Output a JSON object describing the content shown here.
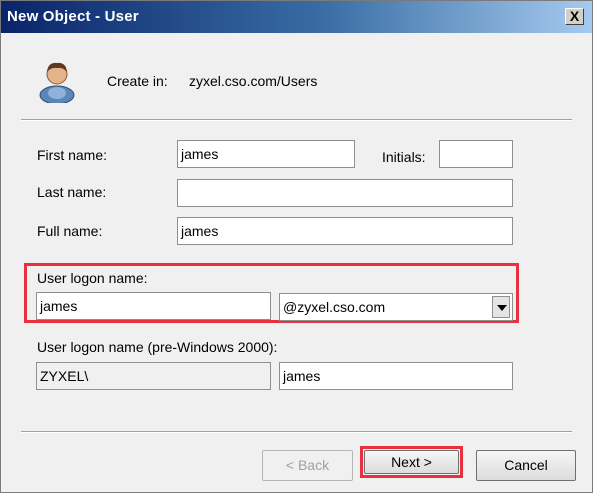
{
  "window": {
    "title": "New Object - User",
    "close_label": "X"
  },
  "header": {
    "create_in_label": "Create in:",
    "create_in_path": "zyxel.cso.com/Users",
    "icon": "user-icon"
  },
  "form": {
    "first_name_label": "First name:",
    "first_name_value": "james",
    "initials_label": "Initials:",
    "initials_value": "",
    "last_name_label": "Last name:",
    "last_name_value": "",
    "full_name_label": "Full name:",
    "full_name_value": "james",
    "logon_label": "User logon name:",
    "logon_value": "james",
    "domain_selected": "@zyxel.cso.com",
    "pre2000_label": "User logon name (pre-Windows 2000):",
    "pre2000_domain": "ZYXEL\\",
    "pre2000_user": "james"
  },
  "buttons": {
    "back": "< Back",
    "next": "Next >",
    "cancel": "Cancel"
  },
  "colors": {
    "highlight": "#e8313e",
    "title_bar": "#0a246a"
  }
}
